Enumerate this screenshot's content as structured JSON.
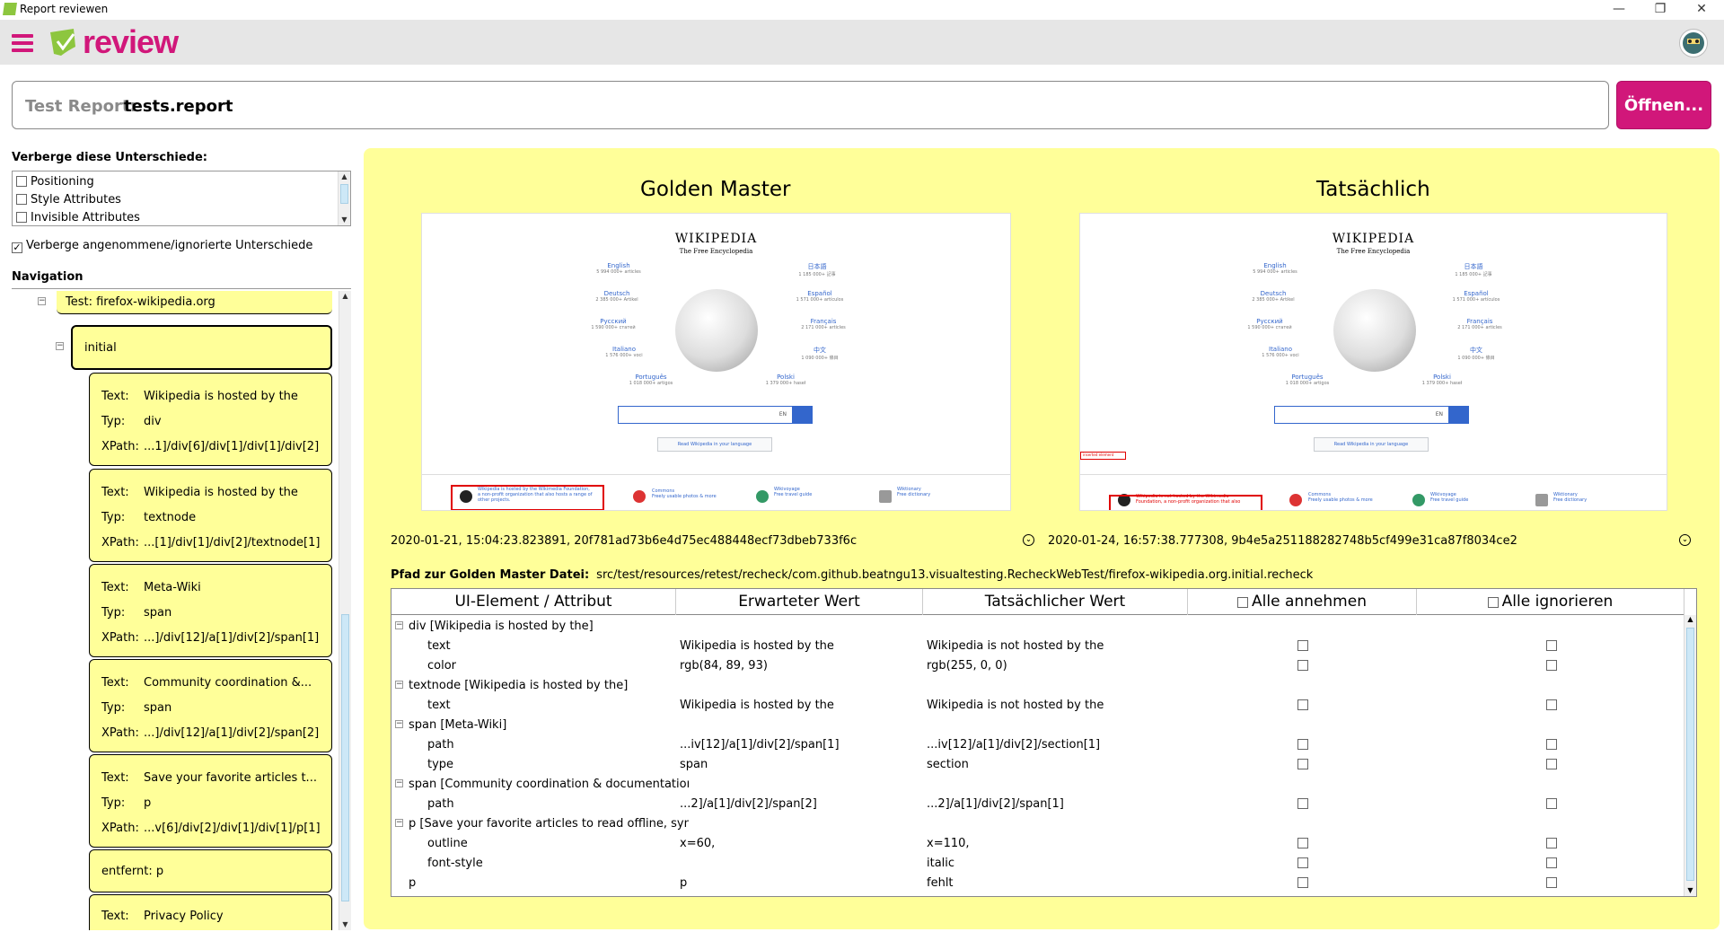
{
  "window": {
    "title": "Report reviewen"
  },
  "header": {
    "logo_text": "review"
  },
  "report": {
    "label": "Test Report:",
    "value": "tests.report",
    "open_button": "Öffnen..."
  },
  "filters": {
    "title": "Verberge diese Unterschiede:",
    "items": [
      {
        "label": "Positioning",
        "checked": false
      },
      {
        "label": "Style Attributes",
        "checked": false
      },
      {
        "label": "Invisible Attributes",
        "checked": false
      }
    ],
    "hide_accepted": {
      "label": "Verberge angenommene/ignorierte Unterschiede",
      "checked": true
    }
  },
  "navigation": {
    "title": "Navigation",
    "test": "Test: firefox-wikipedia.org",
    "state": "initial",
    "labels": {
      "text": "Text:",
      "type": "Typ:",
      "xpath": "XPath:"
    },
    "items": [
      {
        "text": "Wikipedia is hosted by the",
        "type": "div",
        "xpath": "...1]/div[6]/div[1]/div[1]/div[2]"
      },
      {
        "text": "Wikipedia is hosted by the",
        "type": "textnode",
        "xpath": "...[1]/div[1]/div[2]/textnode[1]"
      },
      {
        "text": "Meta-Wiki",
        "type": "span",
        "xpath": "...]/div[12]/a[1]/div[2]/span[1]"
      },
      {
        "text": "Community coordination &...",
        "type": "span",
        "xpath": "...]/div[12]/a[1]/div[2]/span[2]"
      },
      {
        "text": "Save your favorite articles t...",
        "type": "p",
        "xpath": "...v[6]/div[2]/div[1]/div[1]/p[1]"
      }
    ],
    "removed": "entfernt: p",
    "last_item_text": "Privacy Policy"
  },
  "comparison": {
    "golden_title": "Golden Master",
    "actual_title": "Tatsächlich",
    "golden_meta": "2020-01-21, 15:04:23.823891, 20f781ad73b6e4d75ec488448ecf73dbeb733f6c",
    "actual_meta": "2020-01-24, 16:57:38.777308, 9b4e5a251188282748b5cf499e31ca87f8034ce2",
    "path_label": "Pfad zur Golden Master Datei:",
    "path_value": "src/test/resources/retest/recheck/com.github.beatngu13.visualtesting.RecheckWebTest/firefox-wikipedia.org.initial.recheck"
  },
  "screenshot": {
    "wordmark": "WIKIPEDIA",
    "tagline": "The Free Encyclopedia",
    "languages": [
      {
        "name": "English",
        "count": "5 994 000+ articles"
      },
      {
        "name": "日本語",
        "count": "1 185 000+ 記事"
      },
      {
        "name": "Deutsch",
        "count": "2 385 000+ Artikel"
      },
      {
        "name": "Español",
        "count": "1 571 000+ artículos"
      },
      {
        "name": "Русский",
        "count": "1 590 000+ статей"
      },
      {
        "name": "Français",
        "count": "2 171 000+ articles"
      },
      {
        "name": "Italiano",
        "count": "1 576 000+ voci"
      },
      {
        "name": "中文",
        "count": "1 090 000+ 條目"
      },
      {
        "name": "Português",
        "count": "1 018 000+ artigos"
      },
      {
        "name": "Polski",
        "count": "1 379 000+ haseł"
      }
    ],
    "search_lang": "EN",
    "read_lang": "Read Wikipedia in your language",
    "inserted_label": "inserted element",
    "footer": [
      {
        "name": "Commons",
        "desc": "Freely usable photos & more"
      },
      {
        "name": "Wikivoyage",
        "desc": "Free travel guide"
      },
      {
        "name": "Wiktionary",
        "desc": "Free dictionary"
      }
    ],
    "footer_golden": "Wikipedia is hosted by the Wikimedia Foundation, a non-profit organization that also hosts a range of other projects.",
    "footer_actual": "Wikipedia is not hosted by the Wikimedia Foundation, a non-profit organization that also"
  },
  "table": {
    "headers": [
      "UI-Element / Attribut",
      "Erwarteter Wert",
      "Tatsächlicher Wert",
      "Alle annehmen",
      "Alle ignorieren"
    ],
    "rows": [
      {
        "group": true,
        "name": "div [Wikipedia is hosted by the]"
      },
      {
        "name": "text",
        "expected": "Wikipedia is hosted by the",
        "actual": "Wikipedia is not hosted by the"
      },
      {
        "name": "color",
        "expected": "rgb(84, 89, 93)",
        "actual": "rgb(255, 0, 0)"
      },
      {
        "group": true,
        "name": "textnode [Wikipedia is hosted by the]"
      },
      {
        "name": "text",
        "expected": "Wikipedia is hosted by the",
        "actual": "Wikipedia is not hosted by the"
      },
      {
        "group": true,
        "name": "span [Meta-Wiki]"
      },
      {
        "name": "path",
        "expected": "...iv[12]/a[1]/div[2]/span[1]",
        "actual": "...iv[12]/a[1]/div[2]/section[1]"
      },
      {
        "name": "type",
        "expected": "span",
        "actual": "section"
      },
      {
        "group": true,
        "name": "span [Community coordination & documentation]"
      },
      {
        "name": "path",
        "expected": "...2]/a[1]/div[2]/span[2]",
        "actual": "...2]/a[1]/div[2]/span[1]"
      },
      {
        "group": true,
        "name": "p [Save your favorite articles to read offline, sync"
      },
      {
        "name": "outline",
        "expected": "x=60,",
        "actual": "x=110,"
      },
      {
        "name": "font-style",
        "expected": "",
        "actual": "italic"
      },
      {
        "name": "p",
        "expected": "p",
        "actual": "fehlt",
        "top_level": true
      }
    ]
  },
  "colors": {
    "accent": "#d1177a",
    "panel": "#ffff99",
    "header": "#e6e6e6"
  }
}
